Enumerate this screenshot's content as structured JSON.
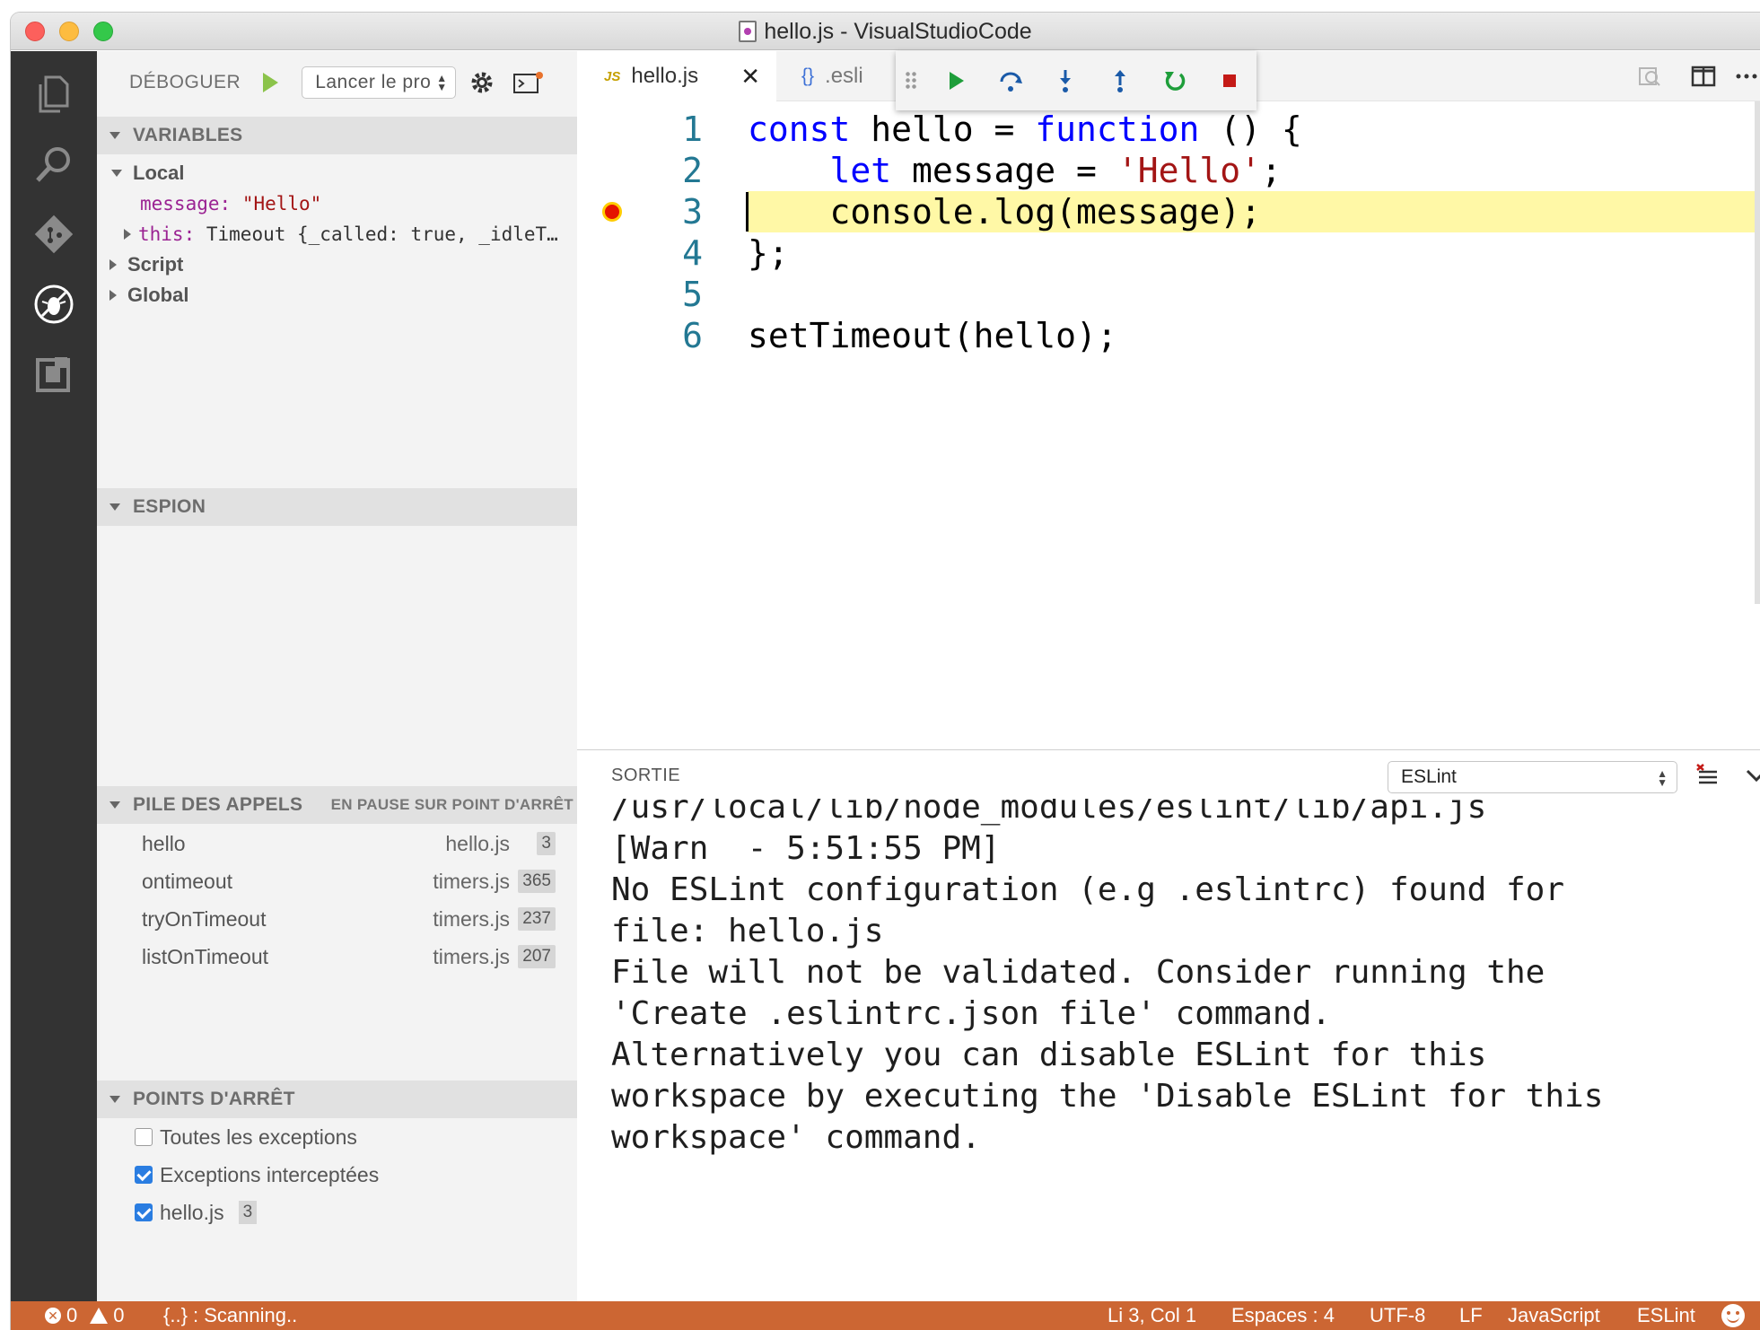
{
  "window": {
    "title": "hello.js - VisualStudioCode"
  },
  "debug_header": {
    "label": "DÉBOGUER",
    "config_select": "Lancer le pro"
  },
  "variables": {
    "header": "VARIABLES",
    "local_label": "Local",
    "message_name": "message:",
    "message_value": "\"Hello\"",
    "this_name": "this:",
    "this_value": "Timeout {_called: true, _idleT…",
    "script_label": "Script",
    "global_label": "Global"
  },
  "watch": {
    "header": "ESPION"
  },
  "callstack": {
    "header": "PILE DES APPELS",
    "status": "EN PAUSE SUR POINT D'ARRÊT",
    "frames": [
      {
        "fn": "hello",
        "file": "hello.js",
        "line": "3"
      },
      {
        "fn": "ontimeout",
        "file": "timers.js",
        "line": "365"
      },
      {
        "fn": "tryOnTimeout",
        "file": "timers.js",
        "line": "237"
      },
      {
        "fn": "listOnTimeout",
        "file": "timers.js",
        "line": "207"
      }
    ]
  },
  "breakpoints": {
    "header": "POINTS D'ARRÊT",
    "items": [
      {
        "label": "Toutes les exceptions",
        "checked": false,
        "line": ""
      },
      {
        "label": "Exceptions interceptées",
        "checked": true,
        "line": ""
      },
      {
        "label": "hello.js",
        "checked": true,
        "line": "3"
      }
    ]
  },
  "tabs": {
    "active": {
      "icon": "JS",
      "label": "hello.js",
      "close": "✕"
    },
    "other": {
      "icon": "{}",
      "label": ".esli"
    }
  },
  "code": {
    "lines": [
      {
        "n": "1",
        "a": "const",
        "b": " hello = ",
        "c": "function",
        "d": " () {"
      },
      {
        "n": "2",
        "a": "    ",
        "b": "let",
        "c": " message = ",
        "d": "'Hello'",
        "e": ";"
      },
      {
        "n": "3",
        "a": "    console.log(message);"
      },
      {
        "n": "4",
        "a": "};"
      },
      {
        "n": "5",
        "a": ""
      },
      {
        "n": "6",
        "a": "setTimeout(hello);"
      }
    ]
  },
  "output": {
    "title": "SORTIE",
    "channel": "ESLint",
    "lines": [
      "/usr/local/lib/node_modules/eslint/lib/api.js",
      "[Warn  - 5:51:55 PM]",
      "No ESLint configuration (e.g .eslintrc) found for",
      "file: hello.js",
      "File will not be validated. Consider running the",
      "'Create .eslintrc.json file' command.",
      "Alternatively you can disable ESLint for this",
      "workspace by executing the 'Disable ESLint for this",
      "workspace' command."
    ]
  },
  "status": {
    "errors": "0",
    "warnings": "0",
    "scanning": "{..} : Scanning..",
    "position": "Li 3, Col 1",
    "spaces": "Espaces : 4",
    "encoding": "UTF-8",
    "eol": "LF",
    "language": "JavaScript",
    "linter": "ESLint"
  },
  "colors": {
    "activity_bar": "#333333",
    "status_bar": "#cc6633",
    "current_line": "#fff8a6",
    "keyword": "#0000ff",
    "string": "#a31515"
  }
}
